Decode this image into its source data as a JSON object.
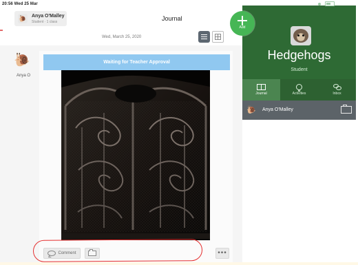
{
  "status": {
    "time_date": "20:56  Wed 25 Mar"
  },
  "header": {
    "student_name": "Anya O'Malley",
    "student_sub": "Student · 1 class",
    "title": "Journal",
    "add_label": "Add"
  },
  "feed": {
    "date": "Wed, March 25, 2020",
    "author_name": "Anya O",
    "approval_text": "Waiting for Teacher Approval",
    "comment_label": "Comment",
    "more_label": "•••"
  },
  "sidebar": {
    "class_name": "Hedgehogs",
    "role": "Student",
    "tabs": [
      {
        "label": "Journal",
        "icon": "book-icon"
      },
      {
        "label": "Activities",
        "icon": "lightbulb-icon"
      },
      {
        "label": "Inbox",
        "icon": "chat-icon"
      }
    ],
    "student_row": {
      "name": "Anya O'Malley"
    }
  },
  "colors": {
    "green_dark": "#2e6a34",
    "green_tab_active": "#4b8550",
    "add_green": "#46b655",
    "banner_blue": "#90c8f0",
    "annotation_red": "#e52f2f"
  }
}
